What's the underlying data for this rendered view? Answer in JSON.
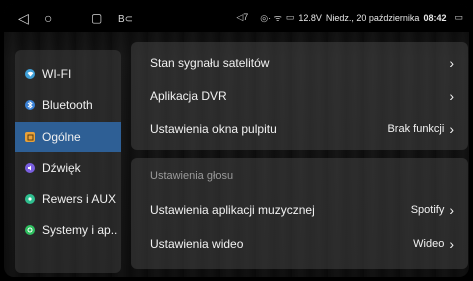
{
  "status_bar": {
    "nav_back": "◁",
    "nav_home": "○",
    "nav_recent": "▢",
    "app_icon": "B⊂",
    "volume_icon": "◁7",
    "signal_icons": "◎· ᯤ",
    "battery_voltage": "12.8V",
    "date": "Niedz., 20 października",
    "time": "08:42",
    "screen_icon": "▭"
  },
  "sidebar": {
    "items": [
      {
        "label": "WI-FI",
        "icon": "wifi-icon",
        "color": "#3fa0d8"
      },
      {
        "label": "Bluetooth",
        "icon": "bluetooth-icon",
        "color": "#3b82d6"
      },
      {
        "label": "Ogólne",
        "icon": "general-settings-icon",
        "color": "#e8a13a",
        "active": true
      },
      {
        "label": "Dźwięk",
        "icon": "sound-icon",
        "color": "#7a5fe0"
      },
      {
        "label": "Rewers i AUX",
        "icon": "reverse-camera-icon",
        "color": "#2fbf8f"
      },
      {
        "label": "Systemy i ap..",
        "icon": "system-apps-icon",
        "color": "#2fbf5f"
      }
    ]
  },
  "main": {
    "group1": [
      {
        "label": "Stan sygnału satelitów",
        "value": ""
      },
      {
        "label": "Aplikacja DVR",
        "value": ""
      },
      {
        "label": "Ustawienia okna pulpitu",
        "value": "Brak funkcji"
      }
    ],
    "group2_header": "Ustawienia głosu",
    "group2": [
      {
        "label": "Ustawienia aplikacji muzycznej",
        "value": "Spotify"
      },
      {
        "label": "Ustawienia wideo",
        "value": "Wideo"
      }
    ],
    "chevron": "›"
  }
}
